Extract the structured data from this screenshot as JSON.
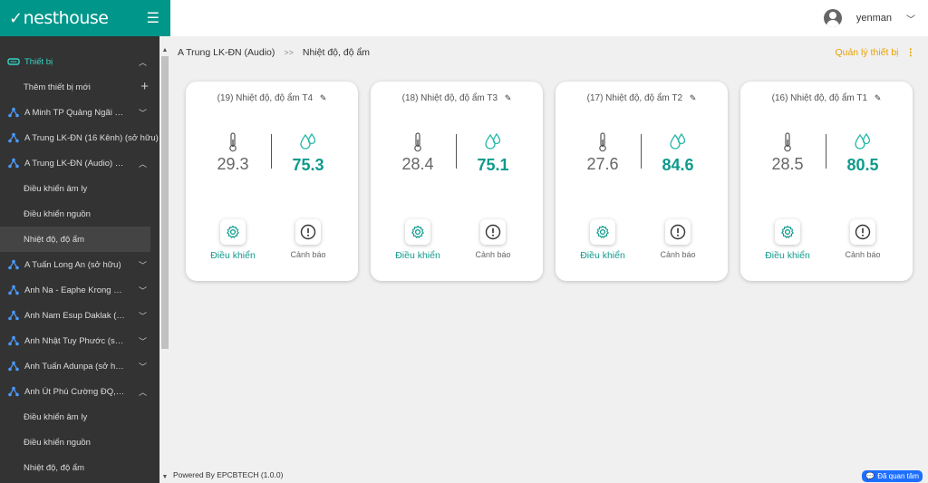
{
  "app": {
    "logo": "nesthouse"
  },
  "header": {
    "username": "yenman"
  },
  "breadcrumb": {
    "parent": "A Trung LK-ĐN (Audio)",
    "separator": ">>",
    "current": "Nhiệt độ, độ ẩm"
  },
  "manage_label": "Quản lý thiết bị",
  "sidebar": {
    "section": "Thiết bị",
    "add_device": "Thêm thiết bị mới",
    "items": [
      {
        "label": "A Minh TP Quảng Ngãi (s..."
      },
      {
        "label": "A Trung LK-ĐN (16 Kênh) (sở hữu)"
      },
      {
        "label": "A Trung LK-ĐN (Audio) (s..."
      },
      {
        "label": "A Tuấn Long An (sở hữu)"
      },
      {
        "label": "Anh Na - Eaphe Krong Pa..."
      },
      {
        "label": "Anh Nam Esup Daklak (s..."
      },
      {
        "label": "Anh Nhật Tuy Phước (sở ..."
      },
      {
        "label": "Anh Tuấn Adunpa (sở hữu)"
      },
      {
        "label": "Anh Út Phú Cường ĐQ,ĐN..."
      }
    ],
    "sub_a": [
      "Điều khiển âm ly",
      "Điều khiển nguồn",
      "Nhiệt độ, độ ẩm"
    ],
    "sub_b": [
      "Điều khiển âm ly",
      "Điều khiển nguồn",
      "Nhiệt độ, độ ẩm"
    ]
  },
  "cards": [
    {
      "title": "(19) Nhiệt độ, độ ẩm T4",
      "temperature": "29.3",
      "humidity": "75.3"
    },
    {
      "title": "(18) Nhiệt độ, độ ẩm T3",
      "temperature": "28.4",
      "humidity": "75.1"
    },
    {
      "title": "(17) Nhiệt độ, độ ẩm T2",
      "temperature": "27.6",
      "humidity": "84.6"
    },
    {
      "title": "(16) Nhiệt độ, độ ẩm T1",
      "temperature": "28.5",
      "humidity": "80.5"
    }
  ],
  "card_labels": {
    "control": "Điều khiển",
    "warning": "Cảnh báo"
  },
  "footer": "Powered By EPCBTECH (1.0.0)",
  "chat_label": "Đã quan tâm",
  "colors": {
    "brand": "#00968a",
    "accent": "#0f9a8c",
    "manage": "#e8a000",
    "sidebar_bg": "#333333"
  }
}
